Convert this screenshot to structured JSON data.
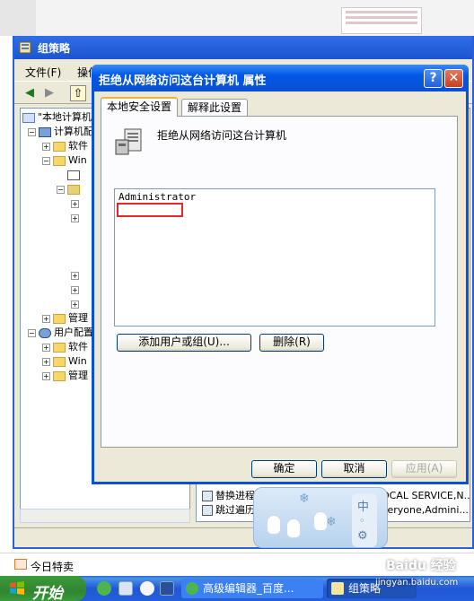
{
  "gp_window": {
    "title": "组策略",
    "menu": [
      "文件(F)",
      "操作"
    ],
    "tree": [
      {
        "label": "\"本地计算机",
        "exp": ""
      },
      {
        "label": "计算机配",
        "exp": "−"
      },
      {
        "label": "软件",
        "exp": "+"
      },
      {
        "label": "Win",
        "exp": "−"
      },
      {
        "label": "",
        "exp": ""
      },
      {
        "label": "",
        "exp": "−"
      },
      {
        "label": "",
        "exp": "+"
      },
      {
        "label": "",
        "exp": "+"
      },
      {
        "label": "",
        "exp": "+"
      },
      {
        "label": "",
        "exp": "+"
      },
      {
        "label": "",
        "exp": "+"
      },
      {
        "label": "管理",
        "exp": "+"
      },
      {
        "label": "用户配置",
        "exp": "−"
      },
      {
        "label": "软件",
        "exp": "+"
      },
      {
        "label": "Win",
        "exp": "+"
      },
      {
        "label": "管理",
        "exp": "+"
      }
    ],
    "policies": [
      {
        "name": "替换进程",
        "value": "OCAL SERVICE,N..."
      },
      {
        "name": "跳过遍历",
        "value": "veryone,Admini..."
      }
    ]
  },
  "dialog": {
    "title": "拒绝从网络访问这台计算机 属性",
    "help_label": "?",
    "close_label": "✕",
    "tabs": [
      "本地安全设置",
      "解释此设置"
    ],
    "policy_name": "拒绝从网络访问这台计算机",
    "users": [
      "Administrator"
    ],
    "add_button": "添加用户或组(U)...",
    "remove_button": "删除(R)",
    "ok_button": "确定",
    "cancel_button": "取消",
    "apply_button": "应用(A)"
  },
  "today_bar": {
    "label": "今日特卖"
  },
  "taskbar": {
    "start_label": "开始",
    "tasks": [
      "高级编辑器_百度...",
      "组策略"
    ]
  },
  "watermark": {
    "text": "Baidu 经验",
    "url": "jingyan.baidu.com"
  },
  "colors": {
    "dialog_title": "#0a50d8",
    "highlight_box": "#e8272b",
    "taskbar": "#245edb",
    "start_button": "#3a9a3a"
  }
}
